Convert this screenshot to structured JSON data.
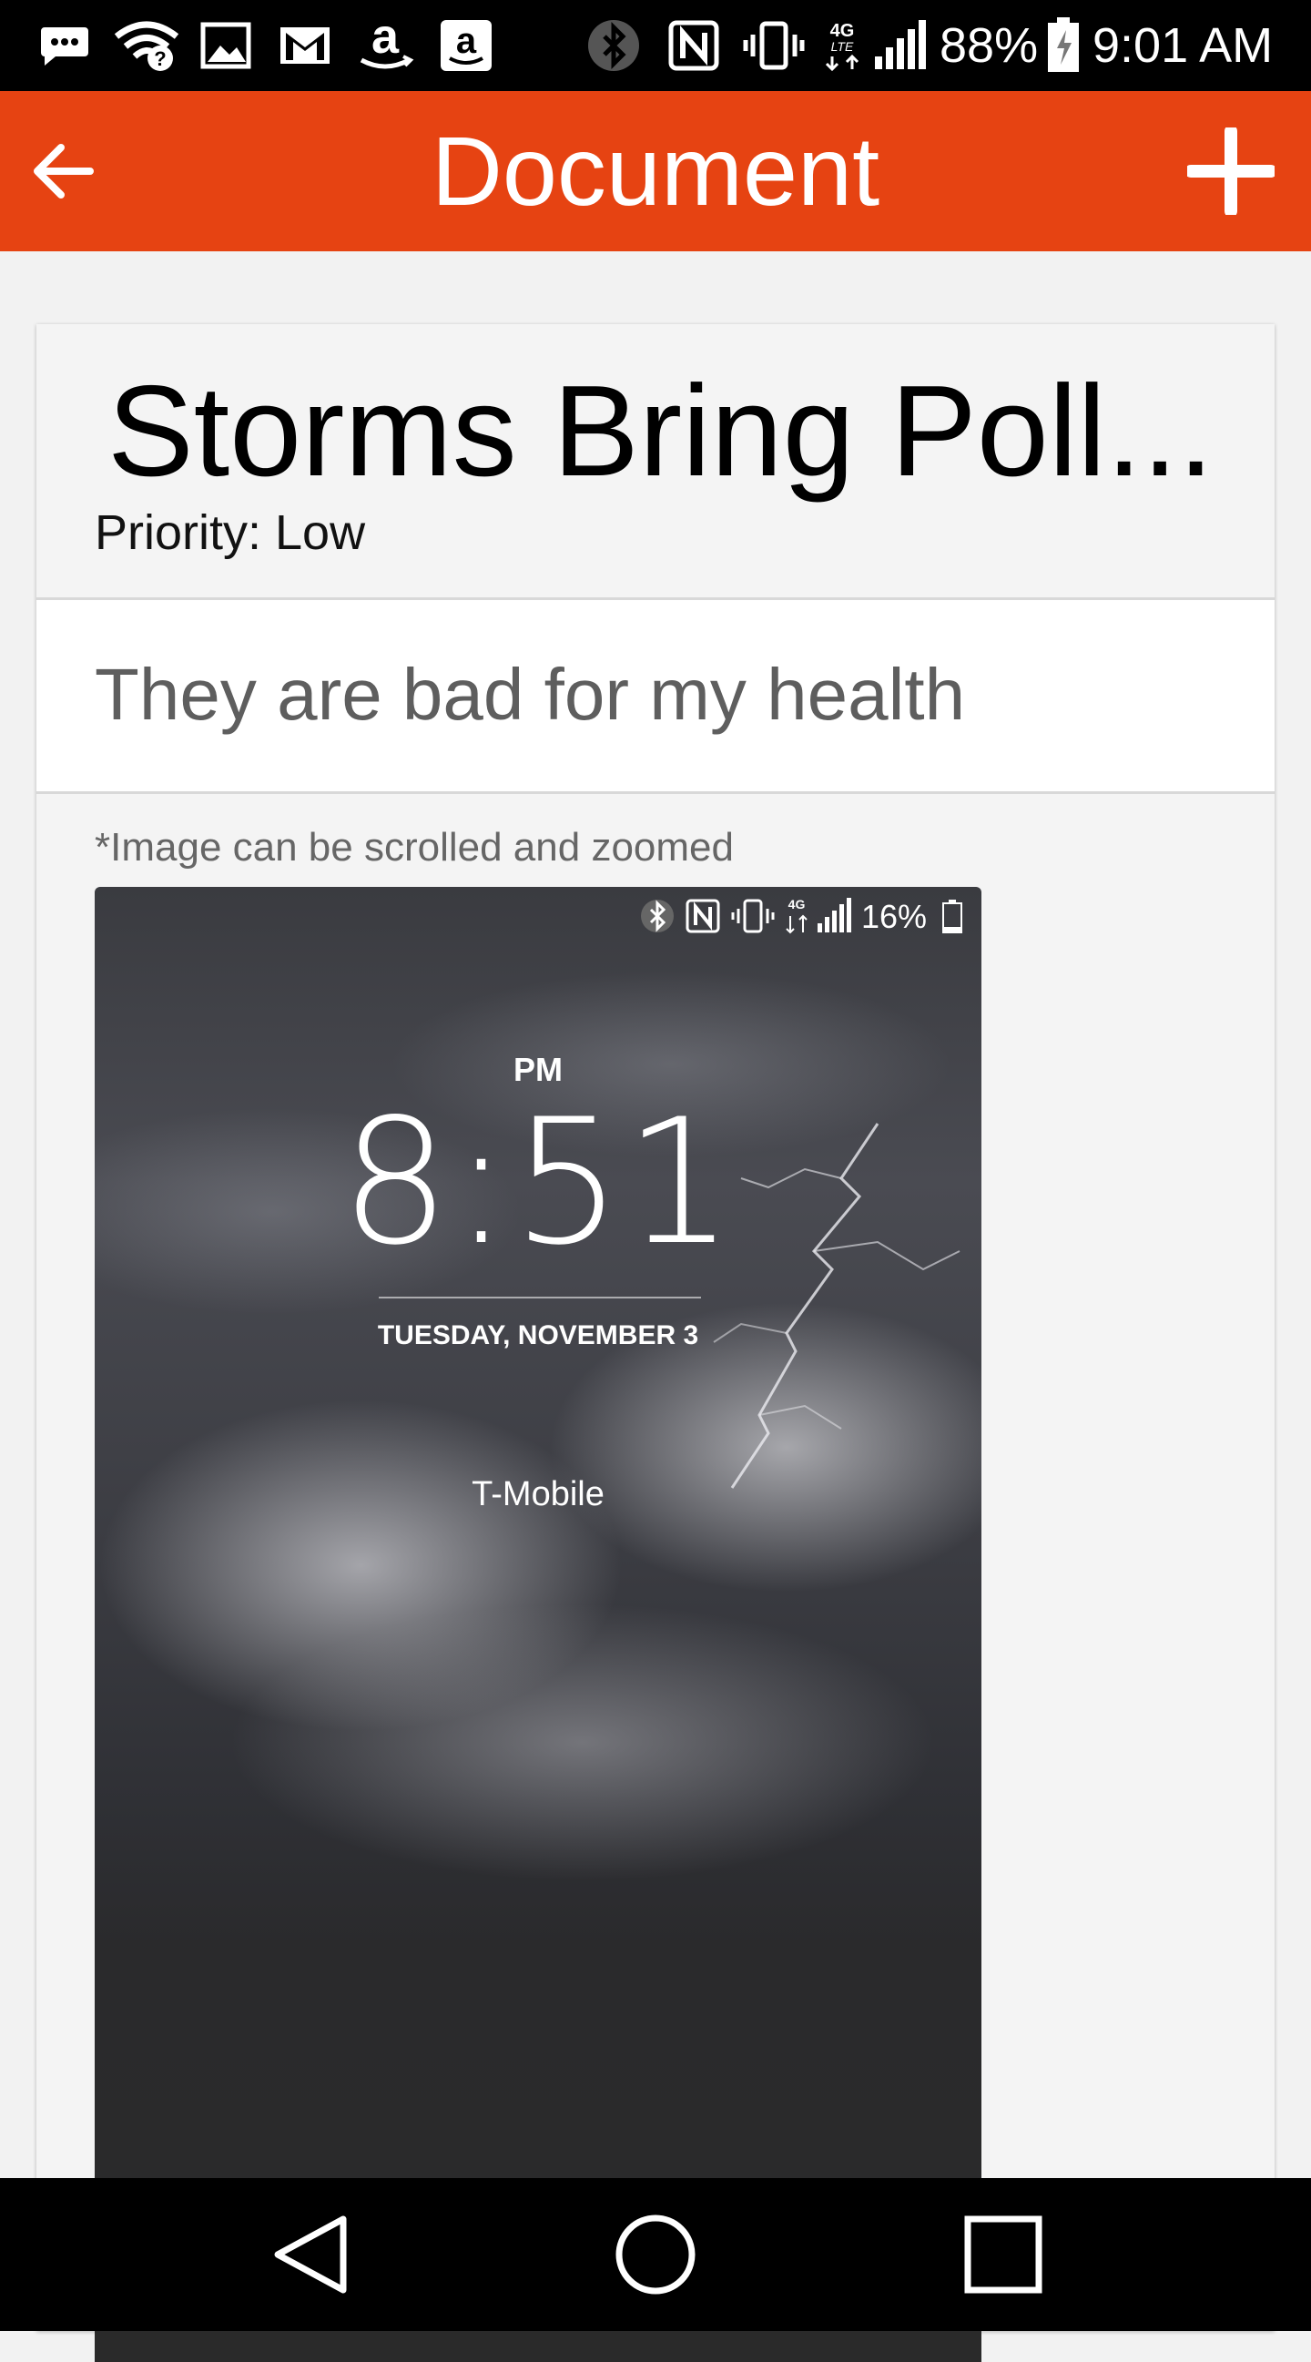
{
  "status_bar": {
    "battery_percent": "88%",
    "time": "9:01 AM",
    "icons": [
      "sms-icon",
      "wifi-question-icon",
      "image-icon",
      "gmail-icon",
      "amazon-icon",
      "amazon-app-icon",
      "bluetooth-icon",
      "nfc-icon",
      "vibrate-icon",
      "lte-icon",
      "signal-icon",
      "battery-charging-icon"
    ]
  },
  "app_bar": {
    "title": "Document",
    "back_icon": "arrow-left-icon",
    "add_icon": "plus-icon",
    "background": "#e64312"
  },
  "document": {
    "title": "Storms Bring Poll...",
    "priority": "Priority: Low",
    "description": "They are bad for my health",
    "image_note": "*Image can be scrolled and zoomed"
  },
  "attached_image": {
    "status_battery": "16%",
    "ampm": "PM",
    "time": "8:51",
    "date": "TUESDAY, NOVEMBER 3",
    "carrier": "T-Mobile"
  },
  "nav_bar": {
    "icons": [
      "back-triangle-icon",
      "home-circle-icon",
      "recents-square-icon"
    ]
  }
}
